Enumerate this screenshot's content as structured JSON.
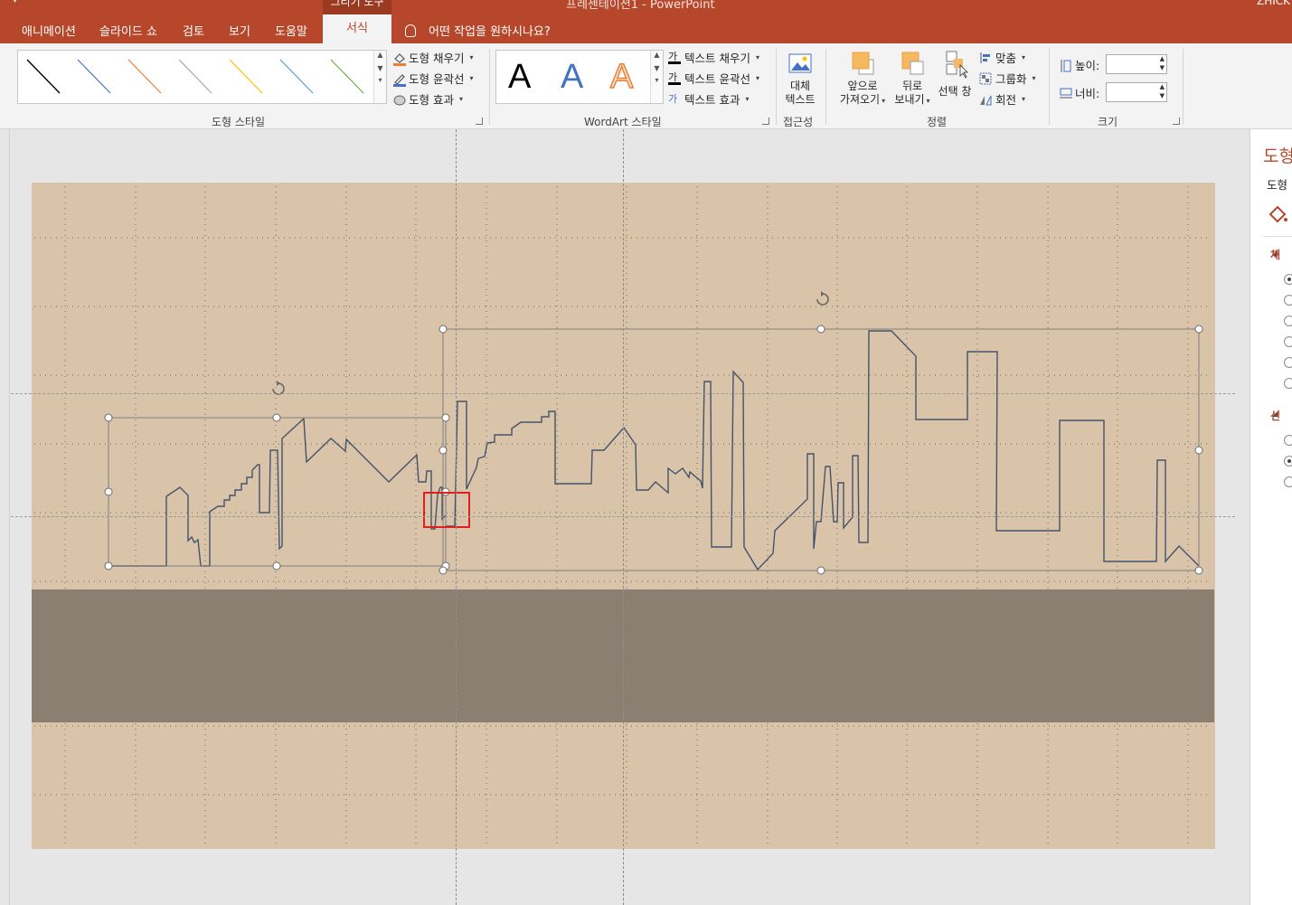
{
  "window": {
    "context_title": "그리기 도구",
    "doc_title": "프레젠테이션1 - PowerPoint",
    "user": "ZHICK"
  },
  "tabs": [
    "애니메이션",
    "슬라이드 쇼",
    "검토",
    "보기",
    "도움말"
  ],
  "active_tab": "서식",
  "tell_me": "어떤 작업을 원하시나요?",
  "ribbon": {
    "shape_styles": {
      "fill": "도형 채우기",
      "outline": "도형 윤곽선",
      "effects": "도형 효과",
      "label": "도형 스타일",
      "line_colors": [
        "#000000",
        "#4472c4",
        "#ed7d31",
        "#a5a5a5",
        "#ffc000",
        "#5b9bd5",
        "#70ad47"
      ]
    },
    "wordart": {
      "letter": "A",
      "text_fill": "텍스트 채우기",
      "text_outline": "텍스트 윤곽선",
      "text_effects": "텍스트 효과",
      "label": "WordArt 스타일",
      "icon_fill_glyph": "가",
      "icon_outline_glyph": "가",
      "icon_effects_glyph": "가"
    },
    "accessibility": {
      "alt_text_line1": "대체",
      "alt_text_line2": "텍스트",
      "label": "접근성"
    },
    "arrange": {
      "bring_forward_line1": "앞으로",
      "bring_forward_line2": "가져오기",
      "send_backward_line1": "뒤로",
      "send_backward_line2": "보내기",
      "selection_pane": "선택 창",
      "align": "맞춤",
      "group": "그룹화",
      "rotate": "회전",
      "label": "정렬"
    },
    "size": {
      "height_label": "높이:",
      "width_label": "너비:",
      "height_value": "",
      "width_value": "",
      "label": "크기"
    }
  },
  "format_pane": {
    "title": "도형",
    "subtitle": "도형",
    "section_fill": "채",
    "section_line": "선"
  }
}
